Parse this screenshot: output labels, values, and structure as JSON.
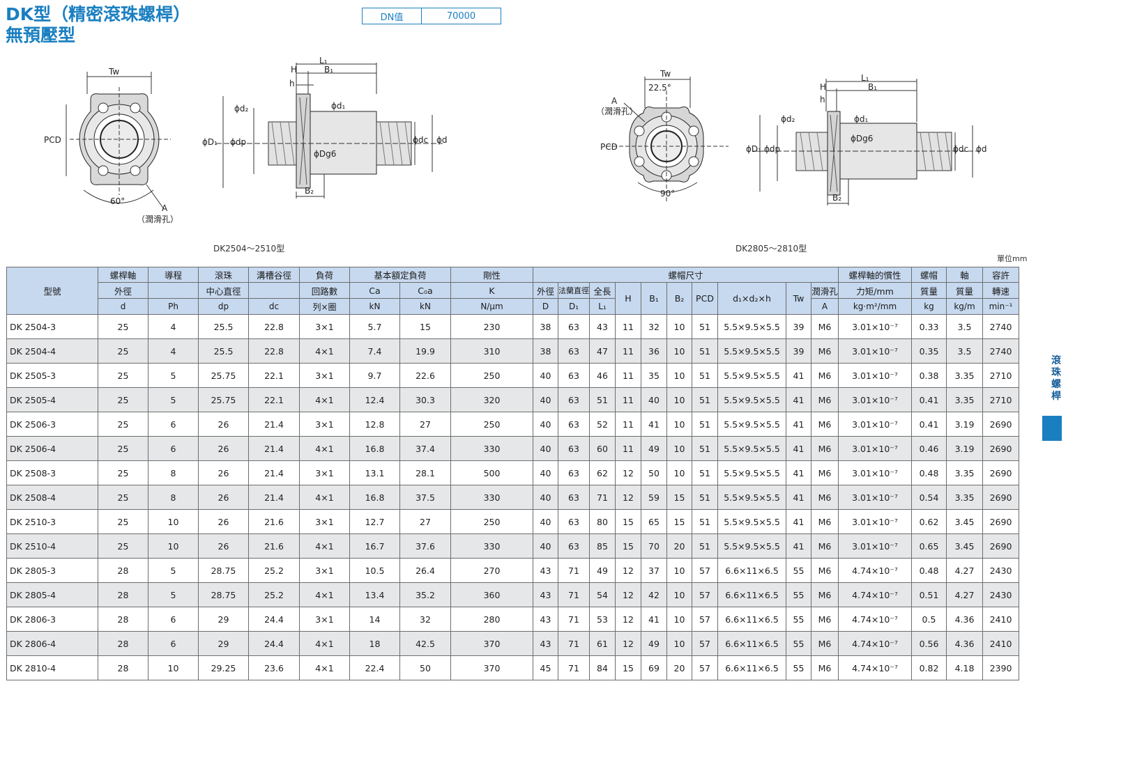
{
  "header": {
    "title_line1": "DK型（精密滾珠螺桿）",
    "title_line2": "無預壓型",
    "dn_label": "DN值",
    "dn_value": "70000"
  },
  "figures": {
    "left_caption": "DK2504～2510型",
    "right_caption": "DK2805～2810型",
    "labels": {
      "tw": "Tw",
      "pcd": "PCD",
      "angle60": "60°",
      "angle90": "90°",
      "angle22": "22.5°",
      "a": "A",
      "lube_hole": "（潤滑孔）",
      "l1": "L₁",
      "h": "H",
      "b1": "B₁",
      "h_small": "h",
      "d2": "ϕd₂",
      "d1": "ϕd₁",
      "D1": "ϕD₁",
      "dp": "ϕdp",
      "dg6": "ϕDg6",
      "dc": "ϕdc",
      "d": "ϕd",
      "b2": "B₂"
    }
  },
  "unit_note": "單位mm",
  "table": {
    "header_row1": {
      "model": "型號",
      "shaft": "螺桿軸",
      "lead": "導程",
      "ball": "滾珠",
      "groove": "溝槽谷徑",
      "load": "負荷",
      "basic": "基本額定負荷",
      "rigidity": "剛性",
      "nut": "螺帽尺寸",
      "inertia": "螺桿軸的慣性",
      "nut_mass": "螺帽",
      "shaft_mass": "軸",
      "speed": "容許"
    },
    "header_row2": {
      "shaft": "外徑",
      "ball": "中心直徑",
      "load": "回路數",
      "ca": "Ca",
      "coa": "C₀a",
      "k": "K",
      "outer": "外徑",
      "flange": "法蘭直徑",
      "length": "全長",
      "h": "H",
      "b1": "B₁",
      "b2": "B₂",
      "pcd": "PCD",
      "bolt": "d₁×d₂×h",
      "tw": "Tw",
      "lube": "潤滑孔",
      "inertia": "力矩/mm",
      "nut_mass": "質量",
      "shaft_mass": "質量",
      "speed": "轉速"
    },
    "header_row3": {
      "shaft": "d",
      "lead": "Ph",
      "ball": "dp",
      "groove": "dc",
      "load": "列×圈",
      "ca": "kN",
      "coa": "kN",
      "k": "N/μm",
      "outer": "D",
      "flange": "D₁",
      "length": "L₁",
      "h": "H",
      "b1": "B₁",
      "b2": "B₂",
      "pcd": "PCD",
      "bolt": "d₁×d₂×h",
      "tw": "Tw",
      "lube": "A",
      "inertia": "kg·m²/mm",
      "nut_mass": "kg",
      "shaft_mass": "kg/m",
      "speed": "min⁻¹"
    },
    "rows": [
      [
        "DK 2504-3",
        "25",
        "4",
        "25.5",
        "22.8",
        "3×1",
        "5.7",
        "15",
        "230",
        "38",
        "63",
        "43",
        "11",
        "32",
        "10",
        "51",
        "5.5×9.5×5.5",
        "39",
        "M6",
        "3.01×10⁻⁷",
        "0.33",
        "3.5",
        "2740"
      ],
      [
        "DK 2504-4",
        "25",
        "4",
        "25.5",
        "22.8",
        "4×1",
        "7.4",
        "19.9",
        "310",
        "38",
        "63",
        "47",
        "11",
        "36",
        "10",
        "51",
        "5.5×9.5×5.5",
        "39",
        "M6",
        "3.01×10⁻⁷",
        "0.35",
        "3.5",
        "2740"
      ],
      [
        "DK 2505-3",
        "25",
        "5",
        "25.75",
        "22.1",
        "3×1",
        "9.7",
        "22.6",
        "250",
        "40",
        "63",
        "46",
        "11",
        "35",
        "10",
        "51",
        "5.5×9.5×5.5",
        "41",
        "M6",
        "3.01×10⁻⁷",
        "0.38",
        "3.35",
        "2710"
      ],
      [
        "DK 2505-4",
        "25",
        "5",
        "25.75",
        "22.1",
        "4×1",
        "12.4",
        "30.3",
        "320",
        "40",
        "63",
        "51",
        "11",
        "40",
        "10",
        "51",
        "5.5×9.5×5.5",
        "41",
        "M6",
        "3.01×10⁻⁷",
        "0.41",
        "3.35",
        "2710"
      ],
      [
        "DK 2506-3",
        "25",
        "6",
        "26",
        "21.4",
        "3×1",
        "12.8",
        "27",
        "250",
        "40",
        "63",
        "52",
        "11",
        "41",
        "10",
        "51",
        "5.5×9.5×5.5",
        "41",
        "M6",
        "3.01×10⁻⁷",
        "0.41",
        "3.19",
        "2690"
      ],
      [
        "DK 2506-4",
        "25",
        "6",
        "26",
        "21.4",
        "4×1",
        "16.8",
        "37.4",
        "330",
        "40",
        "63",
        "60",
        "11",
        "49",
        "10",
        "51",
        "5.5×9.5×5.5",
        "41",
        "M6",
        "3.01×10⁻⁷",
        "0.46",
        "3.19",
        "2690"
      ],
      [
        "DK 2508-3",
        "25",
        "8",
        "26",
        "21.4",
        "3×1",
        "13.1",
        "28.1",
        "500",
        "40",
        "63",
        "62",
        "12",
        "50",
        "10",
        "51",
        "5.5×9.5×5.5",
        "41",
        "M6",
        "3.01×10⁻⁷",
        "0.48",
        "3.35",
        "2690"
      ],
      [
        "DK 2508-4",
        "25",
        "8",
        "26",
        "21.4",
        "4×1",
        "16.8",
        "37.5",
        "330",
        "40",
        "63",
        "71",
        "12",
        "59",
        "15",
        "51",
        "5.5×9.5×5.5",
        "41",
        "M6",
        "3.01×10⁻⁷",
        "0.54",
        "3.35",
        "2690"
      ],
      [
        "DK 2510-3",
        "25",
        "10",
        "26",
        "21.6",
        "3×1",
        "12.7",
        "27",
        "250",
        "40",
        "63",
        "80",
        "15",
        "65",
        "15",
        "51",
        "5.5×9.5×5.5",
        "41",
        "M6",
        "3.01×10⁻⁷",
        "0.62",
        "3.45",
        "2690"
      ],
      [
        "DK 2510-4",
        "25",
        "10",
        "26",
        "21.6",
        "4×1",
        "16.7",
        "37.6",
        "330",
        "40",
        "63",
        "85",
        "15",
        "70",
        "20",
        "51",
        "5.5×9.5×5.5",
        "41",
        "M6",
        "3.01×10⁻⁷",
        "0.65",
        "3.45",
        "2690"
      ],
      [
        "DK 2805-3",
        "28",
        "5",
        "28.75",
        "25.2",
        "3×1",
        "10.5",
        "26.4",
        "270",
        "43",
        "71",
        "49",
        "12",
        "37",
        "10",
        "57",
        "6.6×11×6.5",
        "55",
        "M6",
        "4.74×10⁻⁷",
        "0.48",
        "4.27",
        "2430"
      ],
      [
        "DK 2805-4",
        "28",
        "5",
        "28.75",
        "25.2",
        "4×1",
        "13.4",
        "35.2",
        "360",
        "43",
        "71",
        "54",
        "12",
        "42",
        "10",
        "57",
        "6.6×11×6.5",
        "55",
        "M6",
        "4.74×10⁻⁷",
        "0.51",
        "4.27",
        "2430"
      ],
      [
        "DK 2806-3",
        "28",
        "6",
        "29",
        "24.4",
        "3×1",
        "14",
        "32",
        "280",
        "43",
        "71",
        "53",
        "12",
        "41",
        "10",
        "57",
        "6.6×11×6.5",
        "55",
        "M6",
        "4.74×10⁻⁷",
        "0.5",
        "4.36",
        "2410"
      ],
      [
        "DK 2806-4",
        "28",
        "6",
        "29",
        "24.4",
        "4×1",
        "18",
        "42.5",
        "370",
        "43",
        "71",
        "61",
        "12",
        "49",
        "10",
        "57",
        "6.6×11×6.5",
        "55",
        "M6",
        "4.74×10⁻⁷",
        "0.56",
        "4.36",
        "2410"
      ],
      [
        "DK 2810-4",
        "28",
        "10",
        "29.25",
        "23.6",
        "4×1",
        "22.4",
        "50",
        "370",
        "45",
        "71",
        "84",
        "15",
        "69",
        "20",
        "57",
        "6.6×11×6.5",
        "55",
        "M6",
        "4.74×10⁻⁷",
        "0.82",
        "4.18",
        "2390"
      ]
    ]
  },
  "sidebar": {
    "label": "滾珠螺桿",
    "tab_color": "#1a7fc1"
  },
  "colors": {
    "accent": "#1a7fc1",
    "header_bg": "#c7d9ef",
    "row_alt": "#e6e7e9"
  }
}
